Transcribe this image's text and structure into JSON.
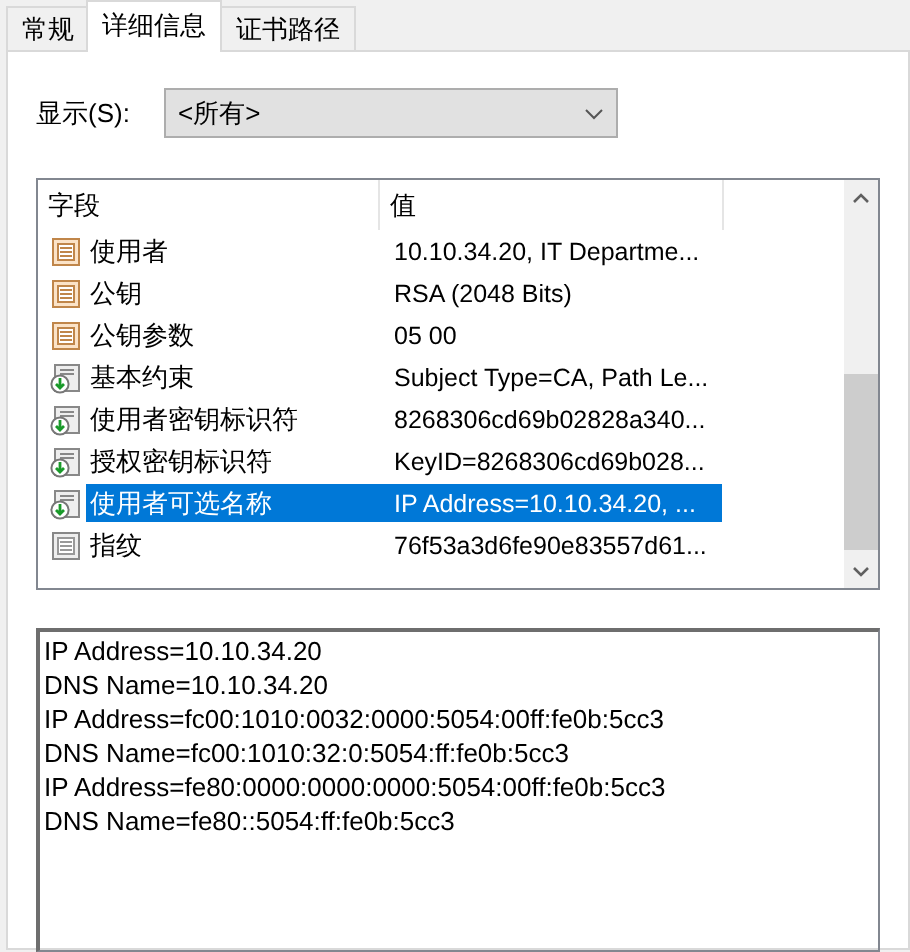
{
  "tabs": [
    {
      "label": "常规",
      "selected": false
    },
    {
      "label": "详细信息",
      "selected": true
    },
    {
      "label": "证书路径",
      "selected": false
    }
  ],
  "show": {
    "label": "显示(S):",
    "value": "<所有>"
  },
  "fields": {
    "columns": [
      "字段",
      "值"
    ],
    "rows": [
      {
        "kind": "property",
        "field": "使用者",
        "value": "10.10.34.20, IT Departme...",
        "selected": false
      },
      {
        "kind": "property",
        "field": "公钥",
        "value": "RSA (2048 Bits)",
        "selected": false
      },
      {
        "kind": "property",
        "field": "公钥参数",
        "value": "05 00",
        "selected": false
      },
      {
        "kind": "extension",
        "field": "基本约束",
        "value": "Subject Type=CA, Path Le...",
        "selected": false
      },
      {
        "kind": "extension",
        "field": "使用者密钥标识符",
        "value": "8268306cd69b02828a340...",
        "selected": false
      },
      {
        "kind": "extension",
        "field": "授权密钥标识符",
        "value": "KeyID=8268306cd69b028...",
        "selected": false
      },
      {
        "kind": "extension",
        "field": "使用者可选名称",
        "value": "IP Address=10.10.34.20, ...",
        "selected": true
      },
      {
        "kind": "thumbprint",
        "field": "指纹",
        "value": "76f53a3d6fe90e83557d61...",
        "selected": false
      }
    ]
  },
  "detail": [
    "IP Address=10.10.34.20",
    "DNS Name=10.10.34.20",
    "IP Address=fc00:1010:0032:0000:5054:00ff:fe0b:5cc3",
    "DNS Name=fc00:1010:32:0:5054:ff:fe0b:5cc3",
    "IP Address=fe80:0000:0000:0000:5054:00ff:fe0b:5cc3",
    "DNS Name=fe80::5054:ff:fe0b:5cc3"
  ]
}
